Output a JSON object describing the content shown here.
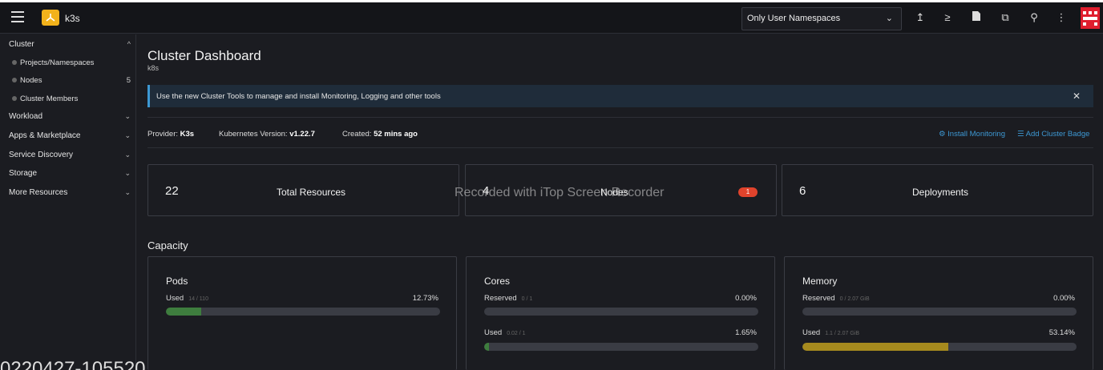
{
  "header": {
    "cluster_name": "k3s",
    "namespace_filter": "Only User Namespaces",
    "icons": [
      "upload-icon",
      "terminal-icon",
      "file-icon",
      "copy-icon",
      "search-icon",
      "more-vert-icon"
    ]
  },
  "sidebar": {
    "cluster": {
      "label": "Cluster",
      "chev": "^"
    },
    "items": [
      {
        "label": "Projects/Namespaces",
        "count": ""
      },
      {
        "label": "Nodes",
        "count": "5"
      },
      {
        "label": "Cluster Members",
        "count": ""
      }
    ],
    "groups": [
      {
        "label": "Workload"
      },
      {
        "label": "Apps & Marketplace"
      },
      {
        "label": "Service Discovery"
      },
      {
        "label": "Storage"
      },
      {
        "label": "More Resources"
      }
    ]
  },
  "main": {
    "title": "Cluster Dashboard",
    "subtitle": "k8s",
    "banner": "Use the new Cluster Tools to manage and install Monitoring, Logging and other tools",
    "provider_label": "Provider:",
    "provider_value": "K3s",
    "k8s_label": "Kubernetes Version:",
    "k8s_value": "v1.22.7",
    "created_label": "Created:",
    "created_value": "52 mins ago",
    "install_monitoring": "Install Monitoring",
    "add_badge": "Add Cluster Badge"
  },
  "cards": [
    {
      "num": "22",
      "label": "Total Resources",
      "badge": ""
    },
    {
      "num": "4",
      "label": "Nodes",
      "badge": "1"
    },
    {
      "num": "6",
      "label": "Deployments",
      "badge": ""
    }
  ],
  "watermark": "Recorded with iTop Screen Recorder",
  "capacity": {
    "title": "Capacity",
    "pods": {
      "title": "Pods",
      "used_label": "Used",
      "used_frac": "14 / 110",
      "used_pct": "12.73%",
      "used_value": 0.1273
    },
    "cores": {
      "title": "Cores",
      "reserved_label": "Reserved",
      "reserved_frac": "0 / 1",
      "reserved_pct": "0.00%",
      "reserved_value": 0,
      "used_label": "Used",
      "used_frac": "0.02 / 1",
      "used_pct": "1.65%",
      "used_value": 0.0165
    },
    "memory": {
      "title": "Memory",
      "reserved_label": "Reserved",
      "reserved_frac": "0 / 2.07 GiB",
      "reserved_pct": "0.00%",
      "reserved_value": 0,
      "used_label": "Used",
      "used_frac": "1.1 / 2.07 GiB",
      "used_pct": "53.14%",
      "used_value": 0.5314
    }
  },
  "recording_text": "0220427-105520",
  "colors": {
    "accent": "#3d98d3",
    "pods_bar": "#3e7d3e",
    "memory_bar": "#a68a1e",
    "badge": "#e0432c"
  }
}
